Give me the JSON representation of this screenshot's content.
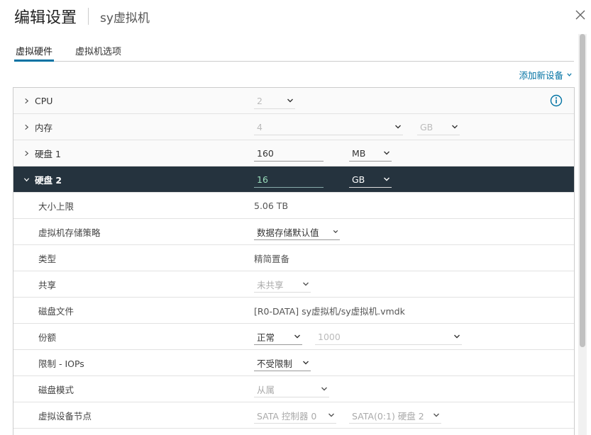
{
  "header": {
    "title": "编辑设置",
    "subtitle": "sy虚拟机"
  },
  "tabs": [
    {
      "label": "虚拟硬件",
      "active": true
    },
    {
      "label": "虚拟机选项",
      "active": false
    }
  ],
  "add_device": {
    "label": "添加新设备"
  },
  "hardware": {
    "cpu": {
      "label": "CPU",
      "value": "2"
    },
    "memory": {
      "label": "内存",
      "value": "4",
      "unit": "GB"
    },
    "disk1": {
      "label": "硬盘 1",
      "value": "160",
      "unit": "MB"
    },
    "disk2": {
      "label": "硬盘 2",
      "value": "16",
      "unit": "GB",
      "max_size": {
        "label": "大小上限",
        "value": "5.06 TB"
      },
      "storage_policy": {
        "label": "虚拟机存储策略",
        "value": "数据存储默认值"
      },
      "type": {
        "label": "类型",
        "value": "精简置备"
      },
      "sharing": {
        "label": "共享",
        "value": "未共享"
      },
      "disk_file": {
        "label": "磁盘文件",
        "value": "[R0-DATA] sy虚拟机/sy虚拟机.vmdk"
      },
      "shares": {
        "label": "份额",
        "value": "正常",
        "amount": "1000"
      },
      "limit_iops": {
        "label": "限制 - IOPs",
        "value": "不受限制"
      },
      "disk_mode": {
        "label": "磁盘模式",
        "value": "从属"
      },
      "device_node": {
        "label": "虚拟设备节点",
        "controller": "SATA 控制器 0",
        "node": "SATA(0:1) 硬盘 2"
      }
    }
  },
  "colors": {
    "accent": "#0072a3",
    "header_row": "#25333e"
  }
}
